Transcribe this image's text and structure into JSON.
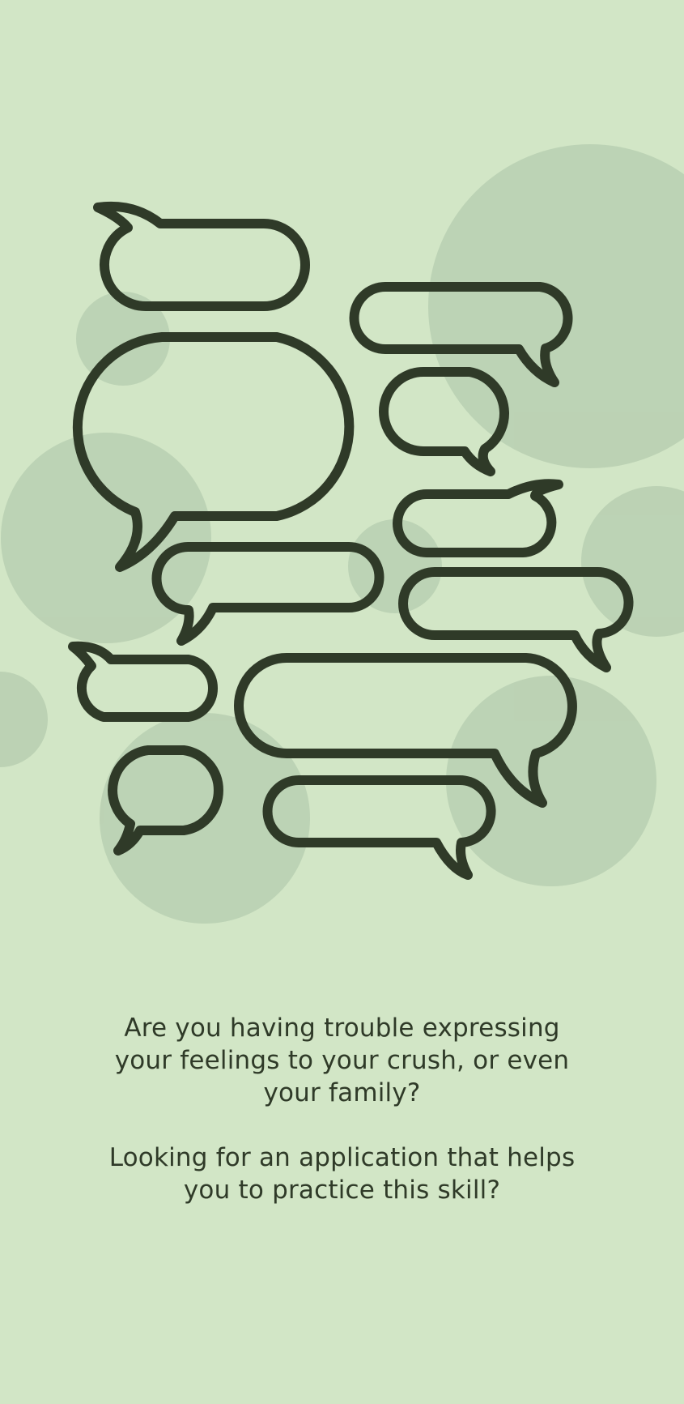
{
  "onboarding": {
    "question_1": "Are you having trouble expressing\nyour feelings to  your crush, or even\nyour family?",
    "question_2": "Looking for an application that helps\nyou to practice this skill?"
  },
  "theme": {
    "background": "#d2e6c6",
    "circle": "#b9cfb1",
    "stroke": "#2f3a28"
  },
  "illustration": {
    "icon_name": "speech-bubbles-illustration"
  }
}
